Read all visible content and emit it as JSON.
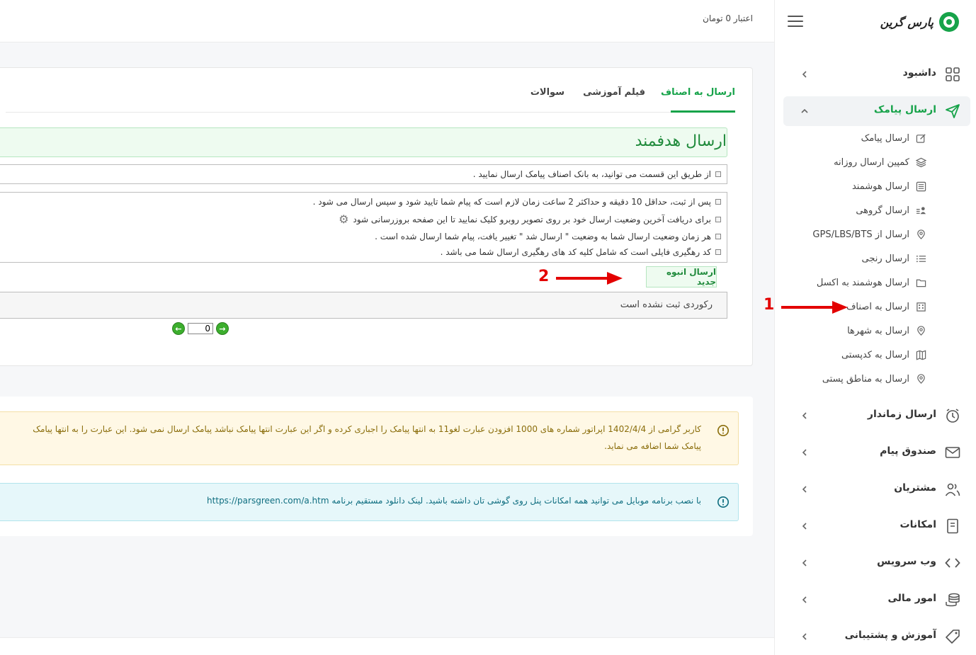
{
  "app": {
    "brand": "پارس گرین",
    "credit": "اعتبار 0 تومان"
  },
  "sidebar": {
    "menu": [
      {
        "label": "داشبود",
        "icon": "grid-icon"
      },
      {
        "label": "ارسال پیامک",
        "icon": "send-icon",
        "active": true
      },
      {
        "label": "ارسال زماندار",
        "icon": "alarm-clock-icon"
      },
      {
        "label": "صندوق پیام",
        "icon": "envelope-icon"
      },
      {
        "label": "مشتریان",
        "icon": "users-icon"
      },
      {
        "label": "امکانات",
        "icon": "document-icon"
      },
      {
        "label": "وب سرویس",
        "icon": "code-icon"
      },
      {
        "label": "امور مالی",
        "icon": "coins-icon"
      },
      {
        "label": "آموزش و پشتیبانی",
        "icon": "tag-icon"
      }
    ],
    "submenu": [
      {
        "label": "ارسال پیامک",
        "icon": "edit-icon"
      },
      {
        "label": "کمپین ارسال روزانه",
        "icon": "layers-icon"
      },
      {
        "label": "ارسال هوشمند",
        "icon": "list-box-icon"
      },
      {
        "label": "ارسال گروهی",
        "icon": "user-list-icon"
      },
      {
        "label": "ارسال از GPS/LBS/BTS",
        "icon": "map-pin-icon"
      },
      {
        "label": "ارسال رنجی",
        "icon": "list-icon"
      },
      {
        "label": "ارسال هوشمند به اکسل",
        "icon": "folder-icon"
      },
      {
        "label": "ارسال به اصناف",
        "icon": "building-icon"
      },
      {
        "label": "ارسال به شهرها",
        "icon": "map-pin-icon"
      },
      {
        "label": "ارسال به کدپستی",
        "icon": "map-icon"
      },
      {
        "label": "ارسال به مناطق پستی",
        "icon": "map-pin-icon"
      }
    ]
  },
  "tabs": [
    {
      "label": "ارسال به اصناف",
      "active": true
    },
    {
      "label": "فیلم آموزشی"
    },
    {
      "label": "سوالات"
    }
  ],
  "main": {
    "title": "ارسال هدفمند",
    "intro": "از طریق این قسمت می توانید، به بانک اصناف پیامک ارسال نمایید .",
    "notes": [
      "پس از ثبت، حداقل  10 دقیقه و حداکثر 2 ساعت زمان لازم است که پیام شما تایید شود و سپس ارسال می شود .",
      "برای دریافت آخرین وضعیت ارسال خود بر روی  تصویر روبرو کلیک نمایید تا این صفحه بروزرسانی شود",
      "هر زمان وضعیت ارسال شما به وضعیت  \" ارسال شد \"  تغییر یافت، پیام شما ارسال شده است .",
      "کد رهگیری فایلی است که شامل کلیه کد های رهگیری ارسال شما می باشد ."
    ],
    "new_button": "ارسال انبوه جدید",
    "no_records": "رکوردی ثبت نشده است",
    "page_value": "0"
  },
  "alerts": {
    "warning_line1": "کاربر گرامی از 1402/4/4 اپراتور شماره های 1000 افزودن عبارت لغو11 به انتها پیامک را اجباری کرده و اگر این عبارت انتها پیامک نباشد پیامک ارسال نمی شود. این عبارت را به انتها پیامک",
    "warning_line2": "پیامک شما اضافه می نماید.",
    "info": "با نصب برنامه موبایل می توانید همه امکانات پنل روی گوشی تان داشته باشید. لینک دانلود مستقیم برنامه https://parsgreen.com/a.htm"
  },
  "annotations": {
    "arrow1": "1",
    "arrow2": "2"
  },
  "colors": {
    "accent": "#17a34a",
    "arrow": "#e30000"
  }
}
